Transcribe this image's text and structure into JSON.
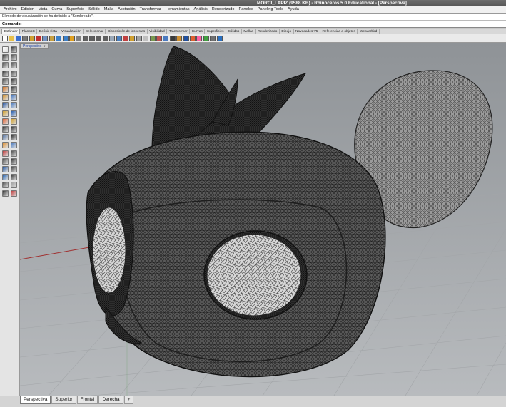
{
  "window": {
    "title": "MORCI_LAPIZ (9588 KB) - Rhinoceros 5.0 Educational - [Perspectiva]"
  },
  "menu": [
    "Archivo",
    "Edición",
    "Vista",
    "Curva",
    "Superficie",
    "Sólido",
    "Malla",
    "Acotación",
    "Transformar",
    "Herramientas",
    "Análisis",
    "Renderizado",
    "Paneles",
    "Paneling Tools",
    "Ayuda"
  ],
  "command": {
    "history": "El modo de visualización se ha definido a \"Sombreado\".",
    "prompt": "Comando:"
  },
  "toolbar_tabs": [
    {
      "label": "Estándar",
      "active": true
    },
    {
      "label": "PlanosC",
      "active": false
    },
    {
      "label": "Definir vista",
      "active": false
    },
    {
      "label": "Visualización",
      "active": false
    },
    {
      "label": "Seleccionar",
      "active": false
    },
    {
      "label": "Disposición de las vistas",
      "active": false
    },
    {
      "label": "Visibilidad",
      "active": false
    },
    {
      "label": "Transformar",
      "active": false
    },
    {
      "label": "Curvas",
      "active": false
    },
    {
      "label": "Superficies",
      "active": false
    },
    {
      "label": "Sólidos",
      "active": false
    },
    {
      "label": "Mallas",
      "active": false
    },
    {
      "label": "Renderizado",
      "active": false
    },
    {
      "label": "Dibujo",
      "active": false
    },
    {
      "label": "Novedades V5",
      "active": false
    },
    {
      "label": "Referencias a objetos",
      "active": false
    },
    {
      "label": "Weaverbird",
      "active": false
    }
  ],
  "toolbar_icons": [
    "new-file-icon",
    "open-file-icon",
    "save-icon",
    "print-icon",
    "import-icon",
    "cut-icon",
    "copy-icon",
    "paste-icon",
    "undo-icon",
    "redo-icon",
    "pan-icon",
    "rotate-view-icon",
    "zoom-icon",
    "zoom-window-icon",
    "zoom-extents-icon",
    "zoom-selected-icon",
    "undo-view-icon",
    "four-viewports-icon",
    "cplane-icon",
    "select-all-icon",
    "hide-icon",
    "lock-icon",
    "layer-icon",
    "properties-icon",
    "wireframe-icon",
    "shaded-icon",
    "rendered-icon",
    "sphere-icon",
    "render-icon",
    "lights-icon",
    "material-icon",
    "options-icon",
    "help-icon"
  ],
  "toolbar_icon_colors": [
    "#ffffff",
    "#e8c04a",
    "#3a6fd0",
    "#777777",
    "#d0a030",
    "#c03030",
    "#7090c0",
    "#c8a040",
    "#3a7fc8",
    "#3a7fc8",
    "#e0a020",
    "#808080",
    "#606060",
    "#606060",
    "#606060",
    "#606060",
    "#9aa8b8",
    "#4a80c0",
    "#c04040",
    "#d0a030",
    "#a0a0a0",
    "#c0c0c0",
    "#7a9a50",
    "#c05050",
    "#4a7ac0",
    "#3a3a3a",
    "#d09030",
    "#2050a0",
    "#e06030",
    "#ff60a0",
    "#40a040",
    "#707070",
    "#2a70c0"
  ],
  "left_tool_icons": [
    "select-icon",
    "point-icon",
    "line-icon",
    "polyline-icon",
    "rectangle-icon",
    "polygon-icon",
    "circle-icon",
    "arc-icon",
    "ellipse-icon",
    "curve-icon",
    "offset-icon",
    "fillet-icon",
    "extrude-icon",
    "loft-icon",
    "sweep-icon",
    "revolve-icon",
    "box-icon",
    "sphere-icon",
    "cylinder-icon",
    "boolean-union-icon",
    "boolean-difference-icon",
    "mesh-icon",
    "move-icon",
    "copy-object-icon",
    "rotate-icon",
    "scale-icon",
    "mirror-icon",
    "array-icon",
    "join-icon",
    "explode-icon",
    "trim-icon",
    "split-icon",
    "dimension-icon",
    "text-icon",
    "group-icon",
    "analysis-icon",
    "check-icon",
    "layer-icon"
  ],
  "left_tool_colors": [
    "#ffffff",
    "#3a3a3a",
    "#3a3a3a",
    "#555555",
    "#555555",
    "#555555",
    "#3a3a3a",
    "#555555",
    "#555555",
    "#3a3a3a",
    "#d07020",
    "#3a3a3a",
    "#d09030",
    "#4a7ac0",
    "#2050a0",
    "#4a7ac0",
    "#d0a030",
    "#2a60b0",
    "#e06030",
    "#d0a030",
    "#3a3a3a",
    "#3a3a3a",
    "#5070a0",
    "#2a2a2a",
    "#e09030",
    "#4a7ac0",
    "#c04040",
    "#555555",
    "#555555",
    "#3a3a3a",
    "#2a5aa0",
    "#4a4a4a",
    "#2060b0",
    "#3a3a3a",
    "#555555",
    "#a0a0a0",
    "#3a3a3a",
    "#c04040"
  ],
  "viewport": {
    "label": "Perspectiva"
  },
  "viewport_tabs": [
    {
      "label": "Perspectiva",
      "active": true
    },
    {
      "label": "Superior",
      "active": false
    },
    {
      "label": "Frontal",
      "active": false
    },
    {
      "label": "Derecha",
      "active": false
    },
    {
      "label": "+",
      "active": false
    }
  ]
}
